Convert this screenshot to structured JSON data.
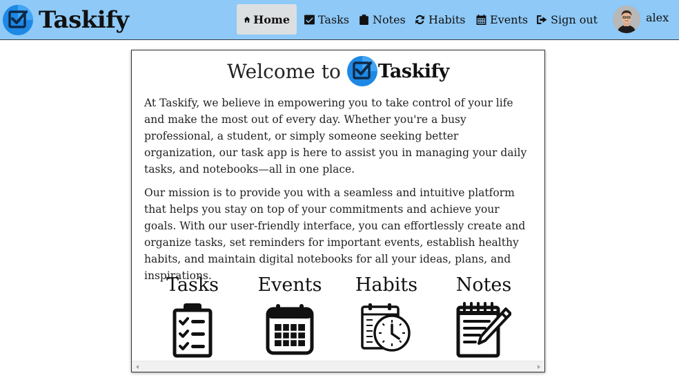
{
  "app": {
    "brand": "Taskify",
    "accent_color": "#8ec9f7",
    "logo_color": "#1e88e5"
  },
  "nav": {
    "items": [
      {
        "label": "Home",
        "icon": "home-icon",
        "active": true
      },
      {
        "label": "Tasks",
        "icon": "check-square-icon",
        "active": false
      },
      {
        "label": "Notes",
        "icon": "clipboard-icon",
        "active": false
      },
      {
        "label": "Habits",
        "icon": "refresh-icon",
        "active": false
      },
      {
        "label": "Events",
        "icon": "calendar-icon",
        "active": false
      },
      {
        "label": "Sign out",
        "icon": "sign-out-icon",
        "active": false
      }
    ],
    "user": {
      "name": "alex",
      "avatar": "user-avatar"
    }
  },
  "welcome": {
    "title_prefix": "Welcome to",
    "brand": "Taskify",
    "paragraphs": [
      "At Taskify, we believe in empowering you to take control of your life and make the most out of every day. Whether you're a busy professional, a student, or simply someone seeking better organization, our task app is here to assist you in managing your daily tasks, and notebooks—all in one place.",
      "Our mission is to provide you with a seamless and intuitive platform that helps you stay on top of your commitments and achieve your goals. With our user-friendly interface, you can effortlessly create and organize tasks, set reminders for important events, establish healthy habits, and maintain digital notebooks for all your ideas, plans, and inspirations."
    ],
    "features": [
      {
        "title": "Tasks",
        "icon": "task-checklist-icon"
      },
      {
        "title": "Events",
        "icon": "calendar-grid-icon"
      },
      {
        "title": "Habits",
        "icon": "habit-calendar-clock-icon"
      },
      {
        "title": "Notes",
        "icon": "notepad-pen-icon"
      }
    ]
  }
}
